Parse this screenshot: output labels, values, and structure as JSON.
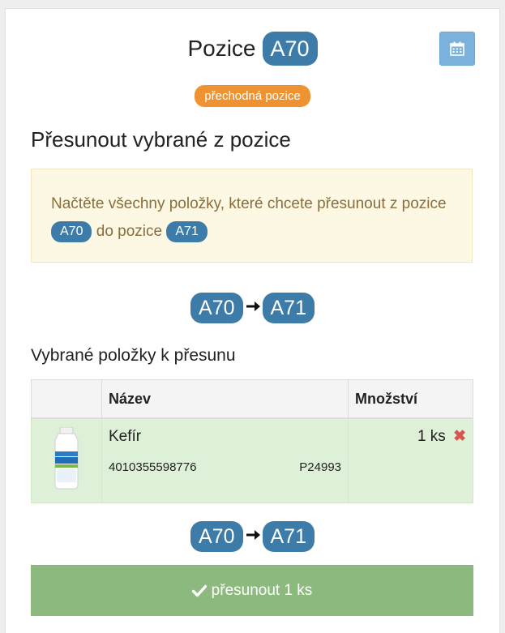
{
  "header": {
    "position_label": "Pozice",
    "position_code": "A70",
    "status_pill": "přechodná pozice",
    "calendar_icon": "calendar-icon"
  },
  "move_section": {
    "title": "Přesunout vybrané z pozice",
    "notice_prefix": "Načtěte všechny položky, které chcete přesunout z pozice",
    "from_code": "A70",
    "notice_middle": "do pozice",
    "to_code": "A71"
  },
  "route": {
    "from": "A70",
    "to": "A71",
    "arrow_icon": "arrow-right-icon"
  },
  "items_section": {
    "title": "Vybrané položky k přesunu",
    "columns": [
      "",
      "Název",
      "Množství"
    ],
    "rows": [
      {
        "image": "kefir-bottle-image",
        "name": "Kefír",
        "ean": "4010355598776",
        "code": "P24993",
        "quantity": "1 ks",
        "remove_icon": "remove-icon"
      }
    ]
  },
  "submit": {
    "icon": "check-icon",
    "label": "přesunout 1 ks"
  },
  "colors": {
    "badge": "#3d7ca9",
    "pill": "#ef9332",
    "warning_bg": "#fcf8e3",
    "row_success": "#dff0d8",
    "submit_bg": "#8cba7e",
    "calendar_btn": "#7bb2dd",
    "remove": "#d9534f"
  }
}
